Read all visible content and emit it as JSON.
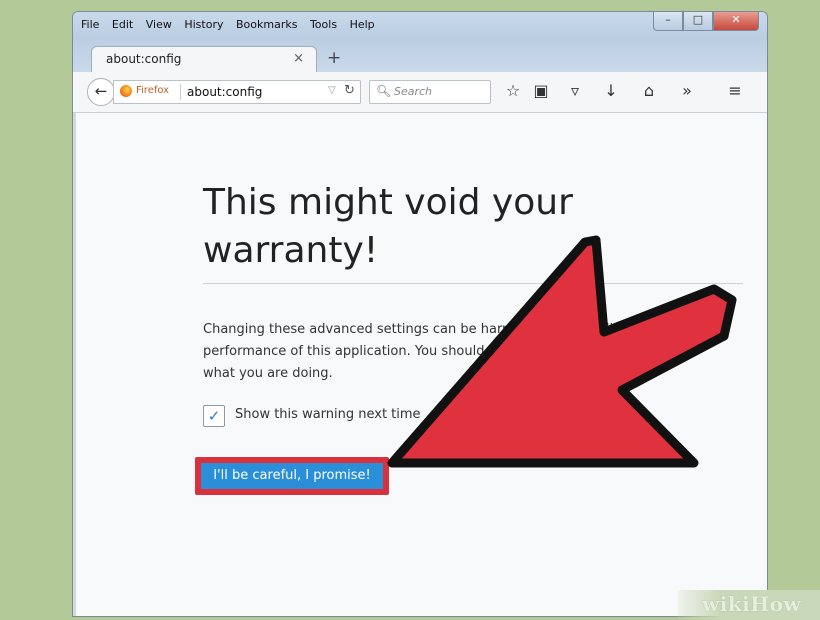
{
  "menu": {
    "file": "File",
    "edit": "Edit",
    "view": "View",
    "history": "History",
    "bookmarks": "Bookmarks",
    "tools": "Tools",
    "help": "Help"
  },
  "window_controls": {
    "minimize": "–",
    "maximize": "□",
    "close": "✕"
  },
  "tab": {
    "label": "about:config",
    "close": "×",
    "new_tab": "+"
  },
  "navbar": {
    "identity": "Firefox",
    "url": "about:config",
    "search_placeholder": "Search"
  },
  "page": {
    "headline": "This might void your warranty!",
    "body": "Changing these advanced settings can be harmful to the stability, security, and performance of this application. You should only continue if you are sure of what you are doing.",
    "checkbox_label": "Show this warning next time",
    "checkbox_checked": true,
    "button_label": "I'll be careful, I promise!"
  },
  "annotation": {
    "arrow_color": "#e0313f"
  },
  "watermark": {
    "text": "wikiHow"
  }
}
